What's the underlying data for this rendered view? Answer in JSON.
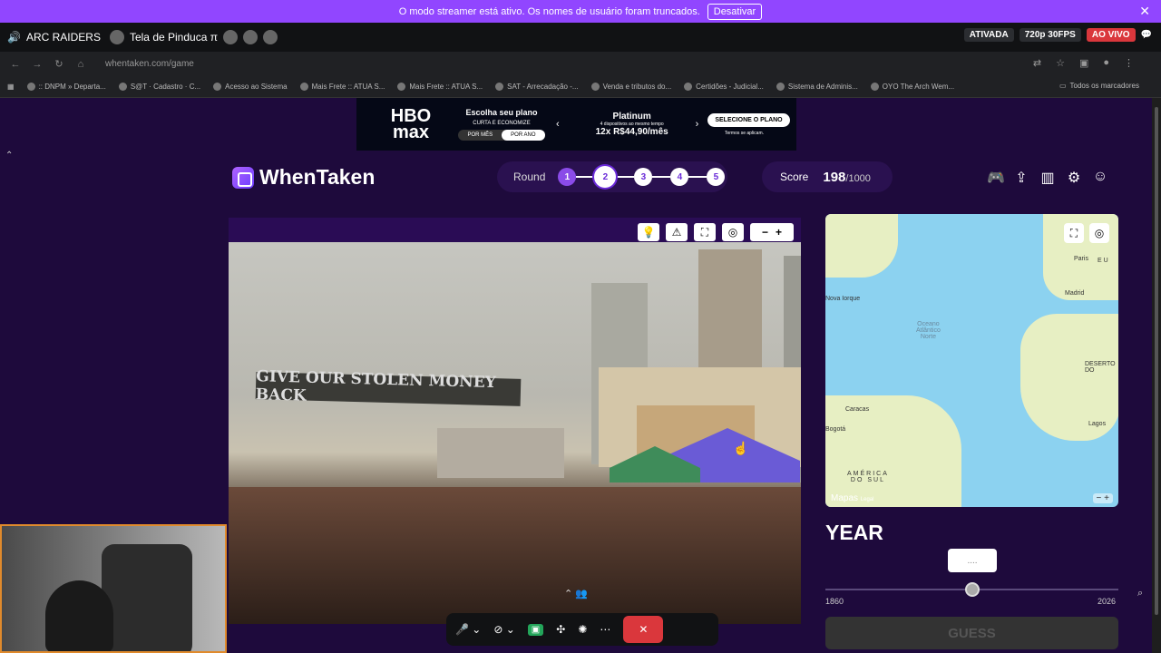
{
  "streamer_banner": {
    "message": "O modo streamer está ativo. Os nomes de usuário foram truncados.",
    "button_label": "Desativar",
    "close": "✕"
  },
  "stream_bar": {
    "server_name": "ARC RAIDERS",
    "screen_name": "Tela de Pinduca π",
    "status_active": "ATIVADA",
    "quality": "720p 30FPS",
    "live": "AO VIVO"
  },
  "browser": {
    "url": "whentaken.com/game",
    "bookmarks": [
      ":: DNPM » Departa...",
      "S@T · Cadastro · C...",
      "Acesso ao Sistema",
      "Mais Frete :: ATUA S...",
      "Mais Frete :: ATUA S...",
      "SAT - Arrecadação -...",
      "Venda e tributos do...",
      "Certidões - Judicial...",
      "Sistema de Adminis...",
      "OYO The Arch Wem..."
    ],
    "all_bookmarks": "Todos os marcadores"
  },
  "ad": {
    "brand": "HBO\nmax",
    "heading": "Escolha seu plano",
    "subheading": "CURTA E ECONOMIZE",
    "toggle_month": "POR MÊS",
    "toggle_year": "POR ANO",
    "plan_name": "Platinum",
    "plan_detail": "4 dispositivos ao mesmo tempo",
    "price": "12x R$44,90/mês",
    "cta": "SELECIONE O PLANO",
    "terms": "Termos se aplicam."
  },
  "app": {
    "brand": "WhenTaken",
    "round_label": "Round",
    "rounds": [
      "1",
      "2",
      "3",
      "4",
      "5"
    ],
    "current_round": 2,
    "score_label": "Score",
    "score_value": "198",
    "score_max": "/1000",
    "photo_banner_text": "GIVE OUR STOLEN MONEY BACK",
    "year_label": "YEAR",
    "year_value": "....",
    "year_min": "1860",
    "year_max": "2026",
    "year_slider_fraction": 0.5,
    "guess_label": "GUESS"
  },
  "map": {
    "labels": {
      "paris": "Paris",
      "eu": "E U",
      "madrid": "Madrid",
      "ny": "Nova Iorque",
      "ocean": "Oceano\nAtlântico\nNorte",
      "desert": "DESERTO DO",
      "caracas": "Caracas",
      "bogota": "Bogotá",
      "lagos": "Lagos",
      "south_america": "AMÉRICA\nDO SUL",
      "maps_brand": "Mapas",
      "legal": "Legal"
    }
  }
}
